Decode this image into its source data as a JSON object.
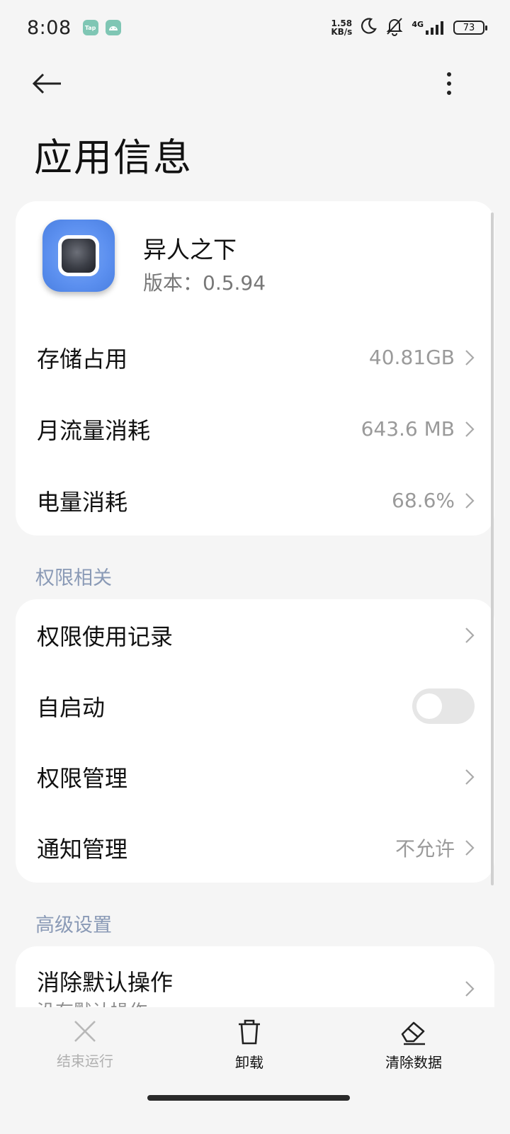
{
  "status_bar": {
    "time": "8:08",
    "app_icons": [
      "Tap",
      "android-icon"
    ],
    "net_speed_value": "1.58",
    "net_speed_unit": "KB/s",
    "signal_label": "4G",
    "battery": "73"
  },
  "page": {
    "title": "应用信息"
  },
  "app": {
    "name": "异人之下",
    "version": "版本：0.5.94"
  },
  "usage_rows": [
    {
      "label": "存储占用",
      "value": "40.81GB"
    },
    {
      "label": "月流量消耗",
      "value": "643.6 MB"
    },
    {
      "label": "电量消耗",
      "value": "68.6%"
    }
  ],
  "permissions_section": {
    "title": "权限相关",
    "rows": [
      {
        "label": "权限使用记录",
        "value": ""
      },
      {
        "label": "自启动",
        "toggle_on": false
      },
      {
        "label": "权限管理",
        "value": ""
      },
      {
        "label": "通知管理",
        "value": "不允许"
      }
    ]
  },
  "advanced_section": {
    "title": "高级设置",
    "rows": [
      {
        "label": "消除默认操作",
        "sub": "没有默认操作"
      }
    ]
  },
  "bottom_bar": {
    "force_stop": "结束运行",
    "uninstall": "卸载",
    "clear_data": "清除数据"
  },
  "colors": {
    "background": "#f5f5f5",
    "card": "#ffffff",
    "section_label": "#8a9ab6",
    "secondary_text": "#9a9a9a"
  }
}
